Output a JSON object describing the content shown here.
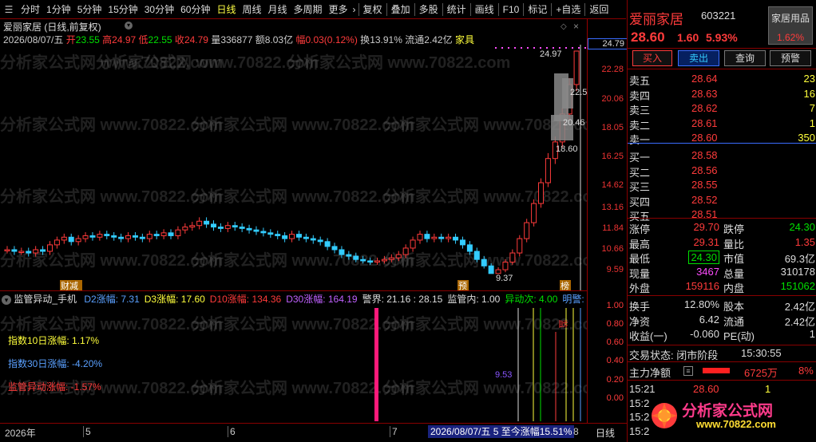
{
  "toolbar": {
    "tabs": [
      "分时",
      "1分钟",
      "5分钟",
      "15分钟",
      "30分钟",
      "60分钟",
      "日线",
      "周线",
      "月线",
      "多周期",
      "更多"
    ],
    "active_tab": "日线",
    "more_arrow": "›",
    "actions": [
      "复权",
      "叠加",
      "多股",
      "统计",
      "画线",
      "F10",
      "标记",
      "+自选",
      "返回"
    ]
  },
  "chart_header": {
    "title": "爱丽家居 (日线,前复权)",
    "line2": {
      "date": "2026/08/07/五",
      "open_label": "开",
      "open": "23.55",
      "high_label": "高",
      "high": "24.97",
      "low_label": "低",
      "low": "22.55",
      "close_label": "收",
      "close": "24.79",
      "vol_label": "量",
      "vol": "336877",
      "amt_label": "额",
      "amt": "8.03亿",
      "chg_label": "幅",
      "chg": "0.03(0.12%)",
      "turn_label": "换",
      "turn": "13.91%",
      "float_label": "流通",
      "float": "2.42亿",
      "sector": "家具"
    }
  },
  "price_axis": [
    "24.79",
    "22.28",
    "20.06",
    "18.05",
    "16.25",
    "14.62",
    "13.16",
    "11.84",
    "10.66",
    "9.59"
  ],
  "price_current": "24.79",
  "chart_annotations": {
    "high_label": "24.97",
    "ann_225": "22.5",
    "ann_2046": "20.46",
    "ann_1860": "18.60",
    "low_label": "9.37",
    "marker1": "财减",
    "marker2": "预",
    "marker3": "榜"
  },
  "indicator_header": {
    "name": "监管异动_手机",
    "items": [
      {
        "label": "D2涨幅: ",
        "value": "7.31",
        "color": "#5aa0ff"
      },
      {
        "label": "D3涨幅: ",
        "value": "17.60",
        "color": "#ffff3b"
      },
      {
        "label": "D10涨幅: ",
        "value": "134.36",
        "color": "#ff3b3b"
      },
      {
        "label": "D30涨幅: ",
        "value": "164.19",
        "color": "#c060ff"
      },
      {
        "label": "警界: ",
        "value": "21.16 : 28.15",
        "color": "#ddd"
      },
      {
        "label": "监管内: ",
        "value": "1.00",
        "color": "#ddd"
      },
      {
        "label": "异动次: ",
        "value": "4.00",
        "color": "#00e000"
      },
      {
        "label": "明警:",
        "value": "",
        "color": "#5aa0ff"
      }
    ]
  },
  "indicator_axis": [
    "1.00",
    "0.80",
    "0.60",
    "0.40",
    "0.20",
    "0.00"
  ],
  "indicator_text": {
    "l1": "指数10日涨幅: 1.17%",
    "l2": "指数30日涨幅: -4.20%",
    "l3": "监管异动涨幅: -1.57%",
    "v953": "9.53",
    "jian": "监"
  },
  "bottom_bar": {
    "year": "2026年",
    "m5": "5",
    "m6": "6",
    "m7": "7",
    "m8": "8",
    "range_text": "2026/08/07/五 5 至今涨幅15.51%",
    "period": "日线"
  },
  "quote": {
    "name": "爱丽家居",
    "code": "603221",
    "price": "28.60",
    "change": "1.60",
    "pct": "5.93%",
    "sector_name": "家居用品",
    "sector_pct": "1.62%",
    "buttons": [
      "买入",
      "卖出",
      "查询",
      "预警"
    ],
    "asks": [
      {
        "label": "卖五",
        "price": "28.64",
        "vol": "23"
      },
      {
        "label": "卖四",
        "price": "28.63",
        "vol": "16"
      },
      {
        "label": "卖三",
        "price": "28.62",
        "vol": "7"
      },
      {
        "label": "卖二",
        "price": "28.61",
        "vol": "1"
      },
      {
        "label": "卖一",
        "price": "28.60",
        "vol": "350"
      }
    ],
    "bids": [
      {
        "label": "买一",
        "price": "28.58",
        "vol": ""
      },
      {
        "label": "买二",
        "price": "28.56",
        "vol": ""
      },
      {
        "label": "买三",
        "price": "28.55",
        "vol": ""
      },
      {
        "label": "买四",
        "price": "28.52",
        "vol": ""
      },
      {
        "label": "买五",
        "price": "28.51",
        "vol": ""
      }
    ],
    "stats": [
      {
        "l1": "涨停",
        "v1": "29.70",
        "c1": "red",
        "l2": "跌停",
        "v2": "24.30",
        "c2": "green"
      },
      {
        "l1": "最高",
        "v1": "29.31",
        "c1": "red",
        "l2": "量比",
        "v2": "1.35",
        "c2": "red"
      },
      {
        "l1": "最低",
        "v1": "24.30",
        "c1": "green",
        "l2": "市值",
        "v2": "69.3亿",
        "c2": "white"
      },
      {
        "l1": "现量",
        "v1": "3467",
        "c1": "mag",
        "l2": "总量",
        "v2": "310178",
        "c2": "white"
      },
      {
        "l1": "外盘",
        "v1": "159116",
        "c1": "red",
        "l2": "内盘",
        "v2": "151062",
        "c2": "green"
      }
    ],
    "stats2": [
      {
        "l1": "换手",
        "v1": "12.80%",
        "l2": "股本",
        "v2": "2.42亿"
      },
      {
        "l1": "净资",
        "v1": "6.42",
        "l2": "流通",
        "v2": "2.42亿"
      },
      {
        "l1": "收益(一)",
        "v1": "-0.060",
        "l2": "PE(动)",
        "v2": "1"
      }
    ],
    "trade_status_label": "交易状态: 闭市阶段",
    "trade_time": "15:30:55",
    "main_flow_label": "主力净额",
    "main_flow_value": "6725万",
    "main_flow_pct": "8%",
    "ticks": [
      {
        "t": "15:21",
        "p": "28.60",
        "v": "1"
      },
      {
        "t": "15:2",
        "p": "",
        "v": ""
      },
      {
        "t": "15:2",
        "p": "",
        "v": ""
      },
      {
        "t": "15:2",
        "p": "",
        "v": ""
      }
    ]
  },
  "watermark": {
    "text": "分析家公式网  www.70822.com",
    "logo_title": "分析家公式网",
    "logo_url": "www.70822.com"
  },
  "colors": {
    "up": "#ff3b3b",
    "down": "#3cf",
    "bg": "#000",
    "grid": "#800"
  }
}
